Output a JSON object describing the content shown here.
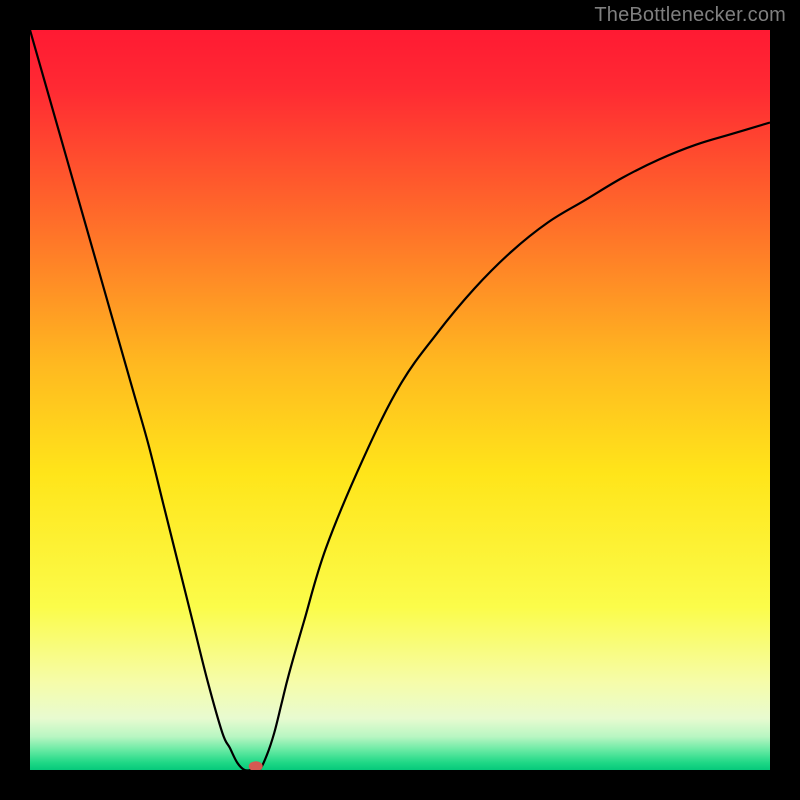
{
  "watermark": "TheBottlenecker.com",
  "chart_data": {
    "type": "line",
    "title": "",
    "xlabel": "",
    "ylabel": "",
    "xlim": [
      0,
      100
    ],
    "ylim": [
      0,
      100
    ],
    "background_gradient_stops": [
      {
        "offset": 0,
        "color": "#ff1a33"
      },
      {
        "offset": 0.08,
        "color": "#ff2a33"
      },
      {
        "offset": 0.25,
        "color": "#ff6a2a"
      },
      {
        "offset": 0.45,
        "color": "#ffb820"
      },
      {
        "offset": 0.6,
        "color": "#ffe51a"
      },
      {
        "offset": 0.78,
        "color": "#fbfc4a"
      },
      {
        "offset": 0.88,
        "color": "#f6fca8"
      },
      {
        "offset": 0.93,
        "color": "#e8fbd0"
      },
      {
        "offset": 0.955,
        "color": "#b8f6c2"
      },
      {
        "offset": 0.975,
        "color": "#5fe8a0"
      },
      {
        "offset": 0.99,
        "color": "#1fd886"
      },
      {
        "offset": 1.0,
        "color": "#06c97b"
      }
    ],
    "series": [
      {
        "name": "bottleneck-curve",
        "x": [
          0,
          2,
          4,
          6,
          8,
          10,
          12,
          14,
          16,
          18,
          20,
          22,
          24,
          26,
          27,
          28,
          29,
          30,
          31,
          32,
          33,
          34,
          35,
          37,
          40,
          45,
          50,
          55,
          60,
          65,
          70,
          75,
          80,
          85,
          90,
          95,
          100
        ],
        "values": [
          100,
          93,
          86,
          79,
          72,
          65,
          58,
          51,
          44,
          36,
          28,
          20,
          12,
          5,
          3,
          1,
          0,
          0,
          0,
          2,
          5,
          9,
          13,
          20,
          30,
          42,
          52,
          59,
          65,
          70,
          74,
          77,
          80,
          82.5,
          84.5,
          86,
          87.5
        ]
      }
    ],
    "marker": {
      "x": 30.5,
      "y": 0.5,
      "color": "#d55a52"
    }
  }
}
